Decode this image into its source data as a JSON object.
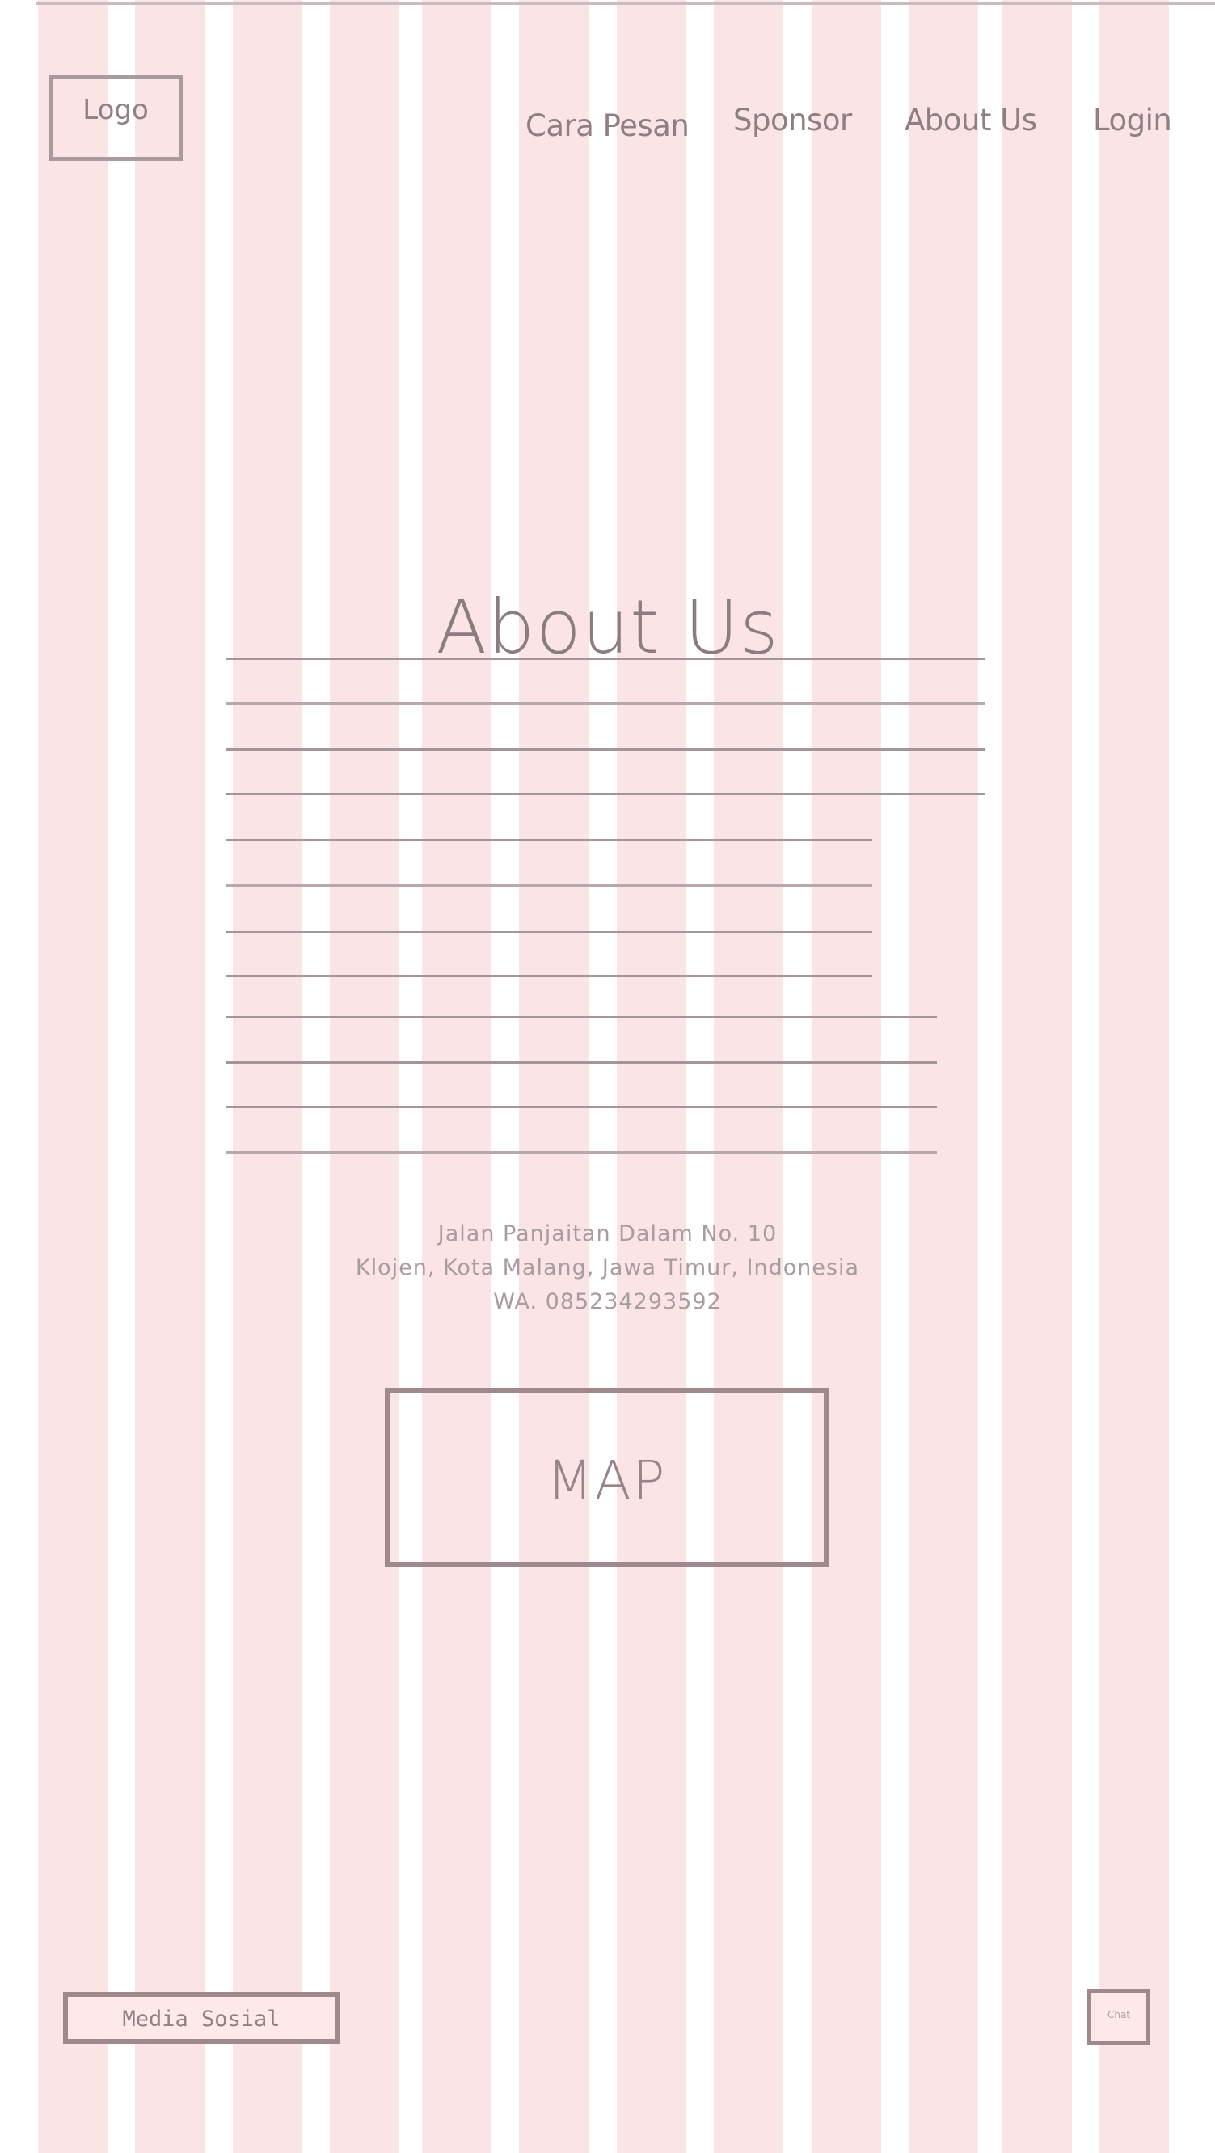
{
  "header": {
    "logo_text": "Logo",
    "nav": [
      "Cara Pesan",
      "Sponsor",
      "About Us",
      "Login"
    ]
  },
  "main": {
    "title": "About Us",
    "address": {
      "street": "Jalan Panjaitan Dalam No. 10",
      "city": "Klojen, Kota Malang, Jawa Timur, Indonesia",
      "phone": "WA. 085234293592"
    },
    "map_label": "MAP"
  },
  "footer": {
    "social_label": "Media Sosial",
    "chat_label": "Chat"
  },
  "colors": {
    "grid_column": "#fbe4e6",
    "wire_line": "#a49598",
    "text": "#8d7f82"
  }
}
